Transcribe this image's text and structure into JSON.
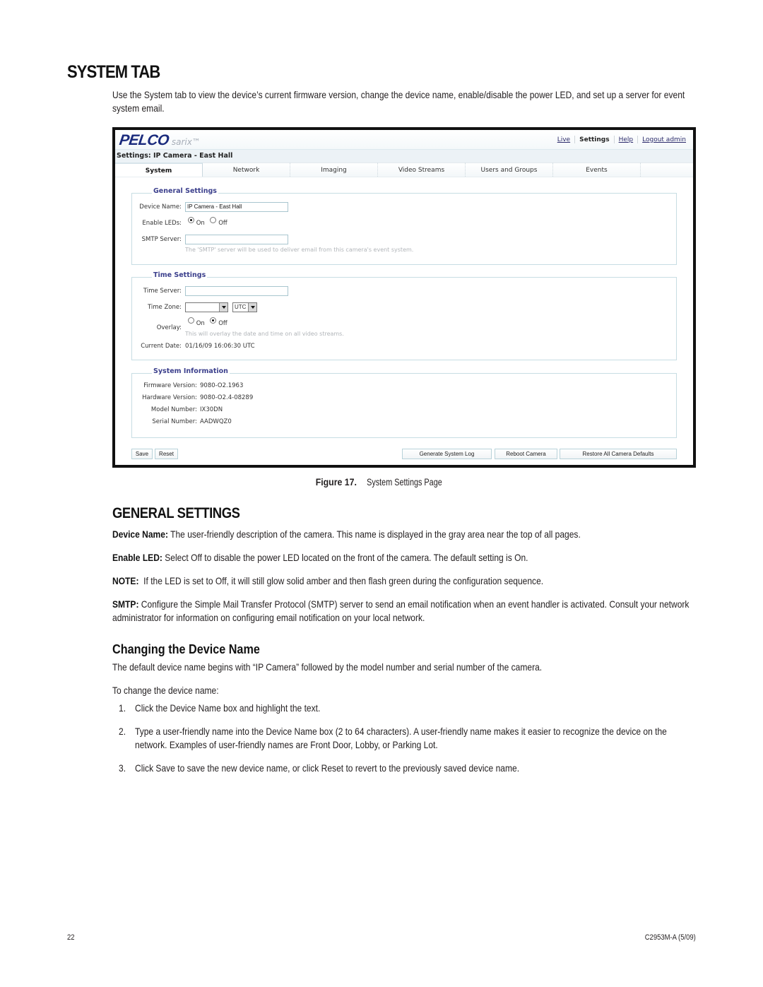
{
  "document": {
    "title": "SYSTEM TAB",
    "intro": "Use the System tab to view the device’s current firmware version, change the device name, enable/disable the power LED, and set up a server for event system email.",
    "figure_caption_label": "Figure 17.",
    "figure_caption_text": "System Settings Page",
    "section_title": "GENERAL SETTINGS",
    "definitions": [
      {
        "term": "Device Name:",
        "text": " The user-friendly description of the camera. This name is displayed in the gray area near the top of all pages."
      },
      {
        "term": "Enable LED:",
        "text": " Select Off to disable the power LED located on the front of the camera. The default setting is On."
      },
      {
        "term": "NOTE:",
        "text": "  If the LED is set to Off, it will still glow solid amber and then flash green during the configuration sequence."
      },
      {
        "term": "SMTP:",
        "text": " Configure the Simple Mail Transfer Protocol (SMTP) server to send an email notification when an event handler is activated. Consult your network administrator for information on configuring email notification on your local network."
      }
    ],
    "subsection_title": "Changing the Device Name",
    "subsection_intro": "The default device name begins with “IP Camera” followed by the model number and serial number of the camera.",
    "steps_intro": "To change the device name:",
    "steps": [
      {
        "num": "1.",
        "text": "Click the Device Name box and highlight the text."
      },
      {
        "num": "2.",
        "text": "Type a user-friendly name into the Device Name box (2 to 64 characters). A user-friendly name makes it easier to recognize the device on the network. Examples of user-friendly names are Front Door, Lobby, or Parking Lot."
      },
      {
        "num": "3.",
        "text": "Click Save to save the new device name, or click Reset to revert to the previously saved device name."
      }
    ],
    "footer_page": "22",
    "footer_doc": "C2953M-A  (5/09)"
  },
  "app": {
    "logo_brand": "PELCO",
    "logo_product": "sarix™",
    "topnav": [
      {
        "label": "Live",
        "current": false
      },
      {
        "label": "Settings",
        "current": true
      },
      {
        "label": "Help",
        "current": false
      },
      {
        "label": "Logout admin",
        "current": false
      }
    ],
    "breadcrumb": "Settings: IP Camera - East Hall",
    "tabs": [
      "System",
      "Network",
      "Imaging",
      "Video Streams",
      "Users and Groups",
      "Events"
    ],
    "active_tab": "System",
    "general": {
      "legend": "General Settings",
      "device_name_label": "Device Name:",
      "device_name_value": "IP Camera - East Hall",
      "leds_label": "Enable LEDs:",
      "leds_on": "On",
      "leds_off": "Off",
      "leds_selected": "On",
      "smtp_label": "SMTP Server:",
      "smtp_value": "",
      "smtp_hint": "The 'SMTP' server will be used to deliver email from this camera's event system."
    },
    "time": {
      "legend": "Time Settings",
      "server_label": "Time Server:",
      "server_value": "",
      "zone_label": "Time Zone:",
      "zone_value": "",
      "zone_suffix": "UTC",
      "overlay_label": "Overlay:",
      "overlay_on": "On",
      "overlay_off": "Off",
      "overlay_selected": "Off",
      "overlay_hint": "This will overlay the date and time on all video streams.",
      "current_date_label": "Current Date:",
      "current_date_value": "01/16/09 16:06:30 UTC"
    },
    "sysinfo": {
      "legend": "System Information",
      "firmware_label": "Firmware Version:",
      "firmware_value": "9080-O2.1963",
      "hardware_label": "Hardware Version:",
      "hardware_value": "9080-O2.4-08289",
      "model_label": "Model Number:",
      "model_value": "IX30DN",
      "serial_label": "Serial Number:",
      "serial_value": "AADWQZ0"
    },
    "buttons": {
      "save": "Save",
      "reset": "Reset",
      "generate_log": "Generate System Log",
      "reboot": "Reboot Camera",
      "restore": "Restore All Camera Defaults"
    }
  }
}
